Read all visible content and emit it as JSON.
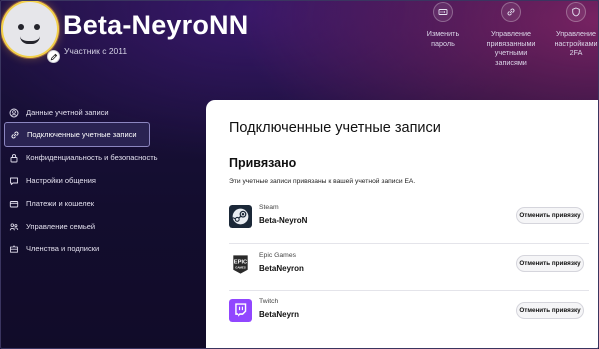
{
  "profile": {
    "username": "Beta-NeyroNN",
    "member_since": "Участник с 2011"
  },
  "quick_actions": [
    {
      "label": "Изменить\nпароль",
      "icon": "password-field-icon"
    },
    {
      "label": "Управление\nпривязанными\nучетными\nзаписями",
      "icon": "link-icon"
    },
    {
      "label": "Управление\nнастройками\n2FA",
      "icon": "shield-icon"
    }
  ],
  "sidebar": {
    "items": [
      {
        "label": "Данные учетной записи",
        "icon": "user-icon",
        "active": false
      },
      {
        "label": "Подключенные учетные записи",
        "icon": "link-icon",
        "active": true
      },
      {
        "label": "Конфиденциальность и безопасность",
        "icon": "lock-icon",
        "active": false
      },
      {
        "label": "Настройки общения",
        "icon": "chat-icon",
        "active": false
      },
      {
        "label": "Платежи и кошелек",
        "icon": "wallet-icon",
        "active": false
      },
      {
        "label": "Управление семьей",
        "icon": "family-icon",
        "active": false
      },
      {
        "label": "Членства и подписки",
        "icon": "membership-icon",
        "active": false
      }
    ]
  },
  "main": {
    "title": "Подключенные учетные записи",
    "linked_section": {
      "title": "Привязано",
      "description": "Эти учетные записи привязаны к вашей учетной записи EA.",
      "accounts": [
        {
          "platform": "Steam",
          "account_name": "Beta-NeyroN",
          "button_label": "Отменить привязку",
          "logo": "steam-logo",
          "logo_color": "#1b2838"
        },
        {
          "platform": "Epic Games",
          "account_name": "BetaNeyron",
          "button_label": "Отменить привязку",
          "logo": "epic-games-logo",
          "logo_color": "#2a2a2a"
        },
        {
          "platform": "Twitch",
          "account_name": "BetaNeyrn",
          "button_label": "Отменить привязку",
          "logo": "twitch-logo",
          "logo_color": "#9146ff"
        }
      ]
    }
  },
  "colors": {
    "background": "#160f33",
    "active_nav": "#2a2352",
    "panel": "#ffffff",
    "avatar_ring": "#f2d04a"
  }
}
